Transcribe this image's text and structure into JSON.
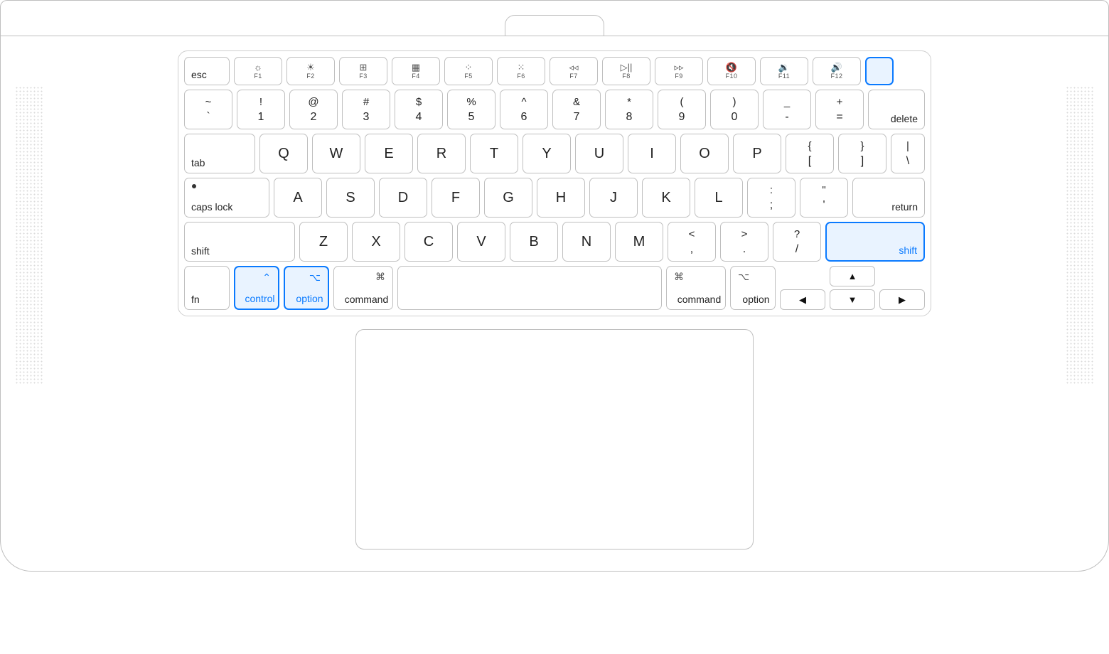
{
  "highlighted_keys": [
    "shift-right",
    "control-left",
    "option-left",
    "touchid"
  ],
  "fn_row": {
    "esc": "esc",
    "keys": [
      {
        "sym": "☼",
        "label": "F1"
      },
      {
        "sym": "☀",
        "label": "F2"
      },
      {
        "sym": "⊞",
        "label": "F3"
      },
      {
        "sym": "▦",
        "label": "F4"
      },
      {
        "sym": "⁘",
        "label": "F5"
      },
      {
        "sym": "⁙",
        "label": "F6"
      },
      {
        "sym": "◃◃",
        "label": "F7"
      },
      {
        "sym": "▷||",
        "label": "F8"
      },
      {
        "sym": "▹▹",
        "label": "F9"
      },
      {
        "sym": "🔇",
        "label": "F10"
      },
      {
        "sym": "🔉",
        "label": "F11"
      },
      {
        "sym": "🔊",
        "label": "F12"
      }
    ]
  },
  "num_row": {
    "keys": [
      {
        "top": "~",
        "bot": "`"
      },
      {
        "top": "!",
        "bot": "1"
      },
      {
        "top": "@",
        "bot": "2"
      },
      {
        "top": "#",
        "bot": "3"
      },
      {
        "top": "$",
        "bot": "4"
      },
      {
        "top": "%",
        "bot": "5"
      },
      {
        "top": "^",
        "bot": "6"
      },
      {
        "top": "&",
        "bot": "7"
      },
      {
        "top": "*",
        "bot": "8"
      },
      {
        "top": "(",
        "bot": "9"
      },
      {
        "top": ")",
        "bot": "0"
      },
      {
        "top": "_",
        "bot": "-"
      },
      {
        "top": "+",
        "bot": "="
      }
    ],
    "delete": "delete"
  },
  "row_q": {
    "tab": "tab",
    "letters": [
      "Q",
      "W",
      "E",
      "R",
      "T",
      "Y",
      "U",
      "I",
      "O",
      "P"
    ],
    "brackets": [
      {
        "top": "{",
        "bot": "["
      },
      {
        "top": "}",
        "bot": "]"
      },
      {
        "top": "|",
        "bot": "\\"
      }
    ]
  },
  "row_a": {
    "capslock": "caps lock",
    "letters": [
      "A",
      "S",
      "D",
      "F",
      "G",
      "H",
      "J",
      "K",
      "L"
    ],
    "punct": [
      {
        "top": ":",
        "bot": ";"
      },
      {
        "top": "\"",
        "bot": "'"
      }
    ],
    "return": "return"
  },
  "row_z": {
    "shift_left": "shift",
    "letters": [
      "Z",
      "X",
      "C",
      "V",
      "B",
      "N",
      "M"
    ],
    "punct": [
      {
        "top": "<",
        "bot": ","
      },
      {
        "top": ">",
        "bot": "."
      },
      {
        "top": "?",
        "bot": "/"
      }
    ],
    "shift_right": "shift"
  },
  "bottom": {
    "fn": "fn",
    "control": "control",
    "option_left": "option",
    "command_left": "command",
    "command_right": "command",
    "option_right": "option",
    "sym_control": "⌃",
    "sym_option": "⌥",
    "sym_command": "⌘"
  },
  "arrows": {
    "up": "▲",
    "down": "▼",
    "left": "◀",
    "right": "▶"
  }
}
